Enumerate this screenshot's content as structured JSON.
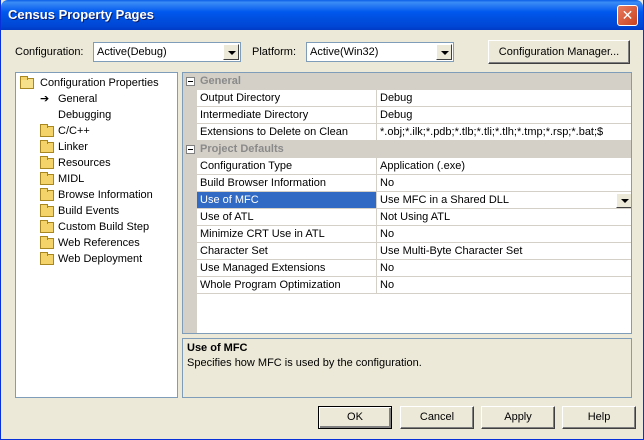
{
  "window": {
    "title": "Census Property Pages",
    "close_glyph": "✕"
  },
  "toolbar": {
    "configuration_label": "Configuration:",
    "configuration_value": "Active(Debug)",
    "platform_label": "Platform:",
    "platform_value": "Active(Win32)",
    "config_manager_label": "Configuration Manager..."
  },
  "tree": {
    "root": "Configuration Properties",
    "items": [
      {
        "label": "General",
        "icon": "arrow-icon"
      },
      {
        "label": "Debugging",
        "icon": "none"
      },
      {
        "label": "C/C++",
        "icon": "folder-icon"
      },
      {
        "label": "Linker",
        "icon": "folder-icon"
      },
      {
        "label": "Resources",
        "icon": "folder-icon"
      },
      {
        "label": "MIDL",
        "icon": "folder-icon"
      },
      {
        "label": "Browse Information",
        "icon": "folder-icon"
      },
      {
        "label": "Build Events",
        "icon": "folder-icon"
      },
      {
        "label": "Custom Build Step",
        "icon": "folder-icon"
      },
      {
        "label": "Web References",
        "icon": "folder-icon"
      },
      {
        "label": "Web Deployment",
        "icon": "folder-icon"
      }
    ]
  },
  "grid": {
    "categories": [
      "General",
      "Project Defaults"
    ],
    "general": [
      {
        "name": "Output Directory",
        "value": "Debug"
      },
      {
        "name": "Intermediate Directory",
        "value": "Debug"
      },
      {
        "name": "Extensions to Delete on Clean",
        "value": "*.obj;*.ilk;*.pdb;*.tlb;*.tli;*.tlh;*.tmp;*.rsp;*.bat;$"
      }
    ],
    "defaults": [
      {
        "name": "Configuration Type",
        "value": "Application (.exe)"
      },
      {
        "name": "Build Browser Information",
        "value": "No"
      },
      {
        "name": "Use of MFC",
        "value": "Use MFC in a Shared DLL"
      },
      {
        "name": "Use of ATL",
        "value": "Not Using ATL"
      },
      {
        "name": "Minimize CRT Use in ATL",
        "value": "No"
      },
      {
        "name": "Character Set",
        "value": "Use Multi-Byte Character Set"
      },
      {
        "name": "Use Managed Extensions",
        "value": "No"
      },
      {
        "name": "Whole Program Optimization",
        "value": "No"
      }
    ]
  },
  "description": {
    "title": "Use of MFC",
    "text": "Specifies how MFC is used by the configuration."
  },
  "buttons": {
    "ok": "OK",
    "cancel": "Cancel",
    "apply": "Apply",
    "help": "Help"
  },
  "colors": {
    "selection": "#316ac5",
    "titlebar": "#0058ee",
    "dialog_bg": "#ece9d8"
  }
}
